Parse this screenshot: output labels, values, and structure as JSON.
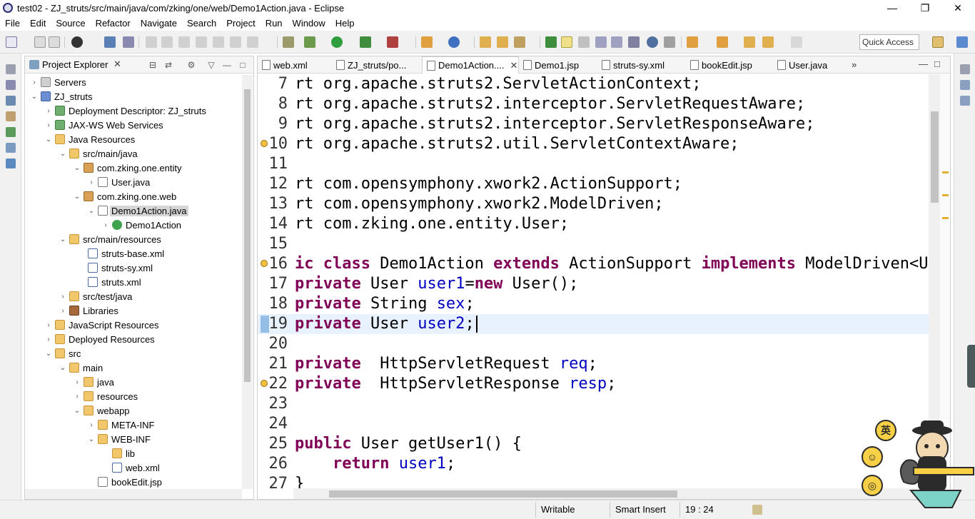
{
  "window": {
    "title": "test02 - ZJ_struts/src/main/java/com/zking/one/web/Demo1Action.java - Eclipse",
    "minimize": "—",
    "restore": "❐",
    "close": "✕"
  },
  "menu": [
    "File",
    "Edit",
    "Source",
    "Refactor",
    "Navigate",
    "Search",
    "Project",
    "Run",
    "Window",
    "Help"
  ],
  "quick_access": "Quick Access",
  "explorer": {
    "tab_label": "Project Explorer",
    "tab_close": "✕",
    "tree": [
      {
        "label": "Servers",
        "icon": "servers-icon"
      },
      {
        "label": "ZJ_struts",
        "icon": "project-icon"
      },
      {
        "label": "Deployment Descriptor: ZJ_struts",
        "icon": "web-icon"
      },
      {
        "label": "JAX-WS Web Services",
        "icon": "web-icon"
      },
      {
        "label": "Java Resources",
        "icon": "folder-icon"
      },
      {
        "label": "src/main/java",
        "icon": "source-folder-icon"
      },
      {
        "label": "com.zking.one.entity",
        "icon": "package-icon"
      },
      {
        "label": "User.java",
        "icon": "java-file-icon"
      },
      {
        "label": "com.zking.one.web",
        "icon": "package-icon"
      },
      {
        "label": "Demo1Action.java",
        "icon": "java-file-icon"
      },
      {
        "label": "Demo1Action",
        "icon": "class-icon"
      },
      {
        "label": "src/main/resources",
        "icon": "source-folder-icon"
      },
      {
        "label": "struts-base.xml",
        "icon": "xml-file-icon"
      },
      {
        "label": "struts-sy.xml",
        "icon": "xml-file-icon"
      },
      {
        "label": "struts.xml",
        "icon": "xml-file-icon"
      },
      {
        "label": "src/test/java",
        "icon": "source-folder-icon"
      },
      {
        "label": "Libraries",
        "icon": "library-icon"
      },
      {
        "label": "JavaScript Resources",
        "icon": "folder-icon"
      },
      {
        "label": "Deployed Resources",
        "icon": "folder-icon"
      },
      {
        "label": "src",
        "icon": "folder-icon"
      },
      {
        "label": "main",
        "icon": "folder-icon"
      },
      {
        "label": "java",
        "icon": "folder-icon"
      },
      {
        "label": "resources",
        "icon": "folder-icon"
      },
      {
        "label": "webapp",
        "icon": "folder-icon"
      },
      {
        "label": "META-INF",
        "icon": "folder-icon"
      },
      {
        "label": "WEB-INF",
        "icon": "folder-icon"
      },
      {
        "label": "lib",
        "icon": "folder-icon"
      },
      {
        "label": "web.xml",
        "icon": "xml-file-icon"
      },
      {
        "label": "bookEdit.jsp",
        "icon": "jsp-file-icon"
      }
    ]
  },
  "editor": {
    "tabs": [
      "web.xml",
      "ZJ_struts/po...",
      "Demo1Action....",
      "Demo1.jsp",
      "struts-sy.xml",
      "bookEdit.jsp",
      "User.java"
    ],
    "active_tab_close": "✕",
    "overflow": "»",
    "lines": [
      {
        "n": "7",
        "parts": [
          [
            "",
            "rt org.apache.struts2.ServletActionContext;"
          ]
        ]
      },
      {
        "n": "8",
        "parts": [
          [
            "",
            "rt org.apache.struts2.interceptor.ServletRequestAware;"
          ]
        ]
      },
      {
        "n": "9",
        "parts": [
          [
            "",
            "rt org.apache.struts2.interceptor.ServletResponseAware;"
          ]
        ]
      },
      {
        "n": "10",
        "parts": [
          [
            "",
            "rt org.apache.struts2.util.ServletContextAware;"
          ]
        ]
      },
      {
        "n": "11",
        "parts": [
          [
            "",
            ""
          ]
        ]
      },
      {
        "n": "12",
        "parts": [
          [
            "",
            "rt com.opensymphony.xwork2.ActionSupport;"
          ]
        ]
      },
      {
        "n": "13",
        "parts": [
          [
            "",
            "rt com.opensymphony.xwork2.ModelDriven;"
          ]
        ]
      },
      {
        "n": "14",
        "parts": [
          [
            "",
            "rt com.zking.one.entity.User;"
          ]
        ]
      },
      {
        "n": "15",
        "parts": [
          [
            "",
            ""
          ]
        ]
      },
      {
        "n": "16",
        "parts": [
          [
            "kw",
            "ic class "
          ],
          [
            "",
            "Demo1Action "
          ],
          [
            "kw",
            "extends "
          ],
          [
            "",
            "ActionSupport "
          ],
          [
            "kw",
            "implements "
          ],
          [
            "",
            "ModelDriven<User"
          ]
        ]
      },
      {
        "n": "17",
        "parts": [
          [
            "kw",
            "private "
          ],
          [
            "",
            "User "
          ],
          [
            "fld",
            "user1"
          ],
          [
            "",
            "="
          ],
          [
            "kw",
            "new "
          ],
          [
            "",
            "User();"
          ]
        ]
      },
      {
        "n": "18",
        "parts": [
          [
            "kw",
            "private "
          ],
          [
            "",
            "String "
          ],
          [
            "fld",
            "sex"
          ],
          [
            "",
            ";"
          ]
        ]
      },
      {
        "n": "19",
        "parts": [
          [
            "kw",
            "private "
          ],
          [
            "",
            "User "
          ],
          [
            "fld",
            "user2"
          ],
          [
            "",
            ";"
          ]
        ]
      },
      {
        "n": "20",
        "parts": [
          [
            "",
            ""
          ]
        ]
      },
      {
        "n": "21",
        "parts": [
          [
            "kw",
            "private  "
          ],
          [
            "",
            "HttpServletRequest "
          ],
          [
            "fld",
            "req"
          ],
          [
            "",
            ";"
          ]
        ]
      },
      {
        "n": "22",
        "parts": [
          [
            "kw",
            "private  "
          ],
          [
            "",
            "HttpServletResponse "
          ],
          [
            "fld",
            "resp"
          ],
          [
            "",
            ";"
          ]
        ]
      },
      {
        "n": "23",
        "parts": [
          [
            "",
            ""
          ]
        ]
      },
      {
        "n": "24",
        "parts": [
          [
            "",
            ""
          ]
        ]
      },
      {
        "n": "25",
        "parts": [
          [
            "kw",
            "public "
          ],
          [
            "",
            "User getUser1() {"
          ]
        ]
      },
      {
        "n": "26",
        "parts": [
          [
            "",
            "    "
          ],
          [
            "kw",
            "return "
          ],
          [
            "fld",
            "user1"
          ],
          [
            "",
            ";"
          ]
        ]
      },
      {
        "n": "27",
        "parts": [
          [
            "",
            "}"
          ]
        ]
      }
    ]
  },
  "status": {
    "writable": "Writable",
    "insert_mode": "Smart Insert",
    "position": "19 : 24"
  },
  "ime": {
    "lang_button": "英"
  },
  "colors": {
    "keyword": "#7f0055",
    "field": "#0000c0",
    "current_line": "#e8f2fe"
  }
}
